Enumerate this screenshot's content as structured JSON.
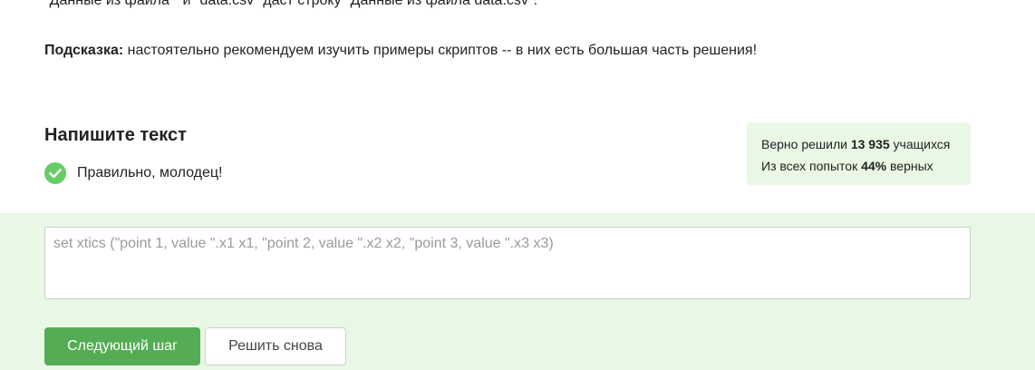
{
  "step_text": {
    "prev_line": "\"Данные из файла \" и \"data.csv\" даст строку \"Данные из файла data.csv\".",
    "hint_label": "Подсказка:",
    "hint_text": " настоятельно рекомендуем изучить примеры скриптов -- в них есть большая часть решения!"
  },
  "task": {
    "title": "Напишите текст",
    "feedback": "Правильно, молодец!",
    "feedback_icon": "check-circle-icon",
    "success_color": "#54ad54"
  },
  "stats": {
    "solved_prefix": "Верно решили ",
    "solved_count": "13 935",
    "solved_suffix": " учащихся",
    "attempts_prefix": "Из всех попыток ",
    "attempts_percent": "44%",
    "attempts_suffix": " верных"
  },
  "answer": {
    "value": "set xtics (\"point 1, value \".x1 x1, \"point 2, value \".x2 x2, \"point 3, value \".x3 x3)"
  },
  "buttons": {
    "next_label": "Следующий шаг",
    "retry_label": "Решить снова"
  }
}
